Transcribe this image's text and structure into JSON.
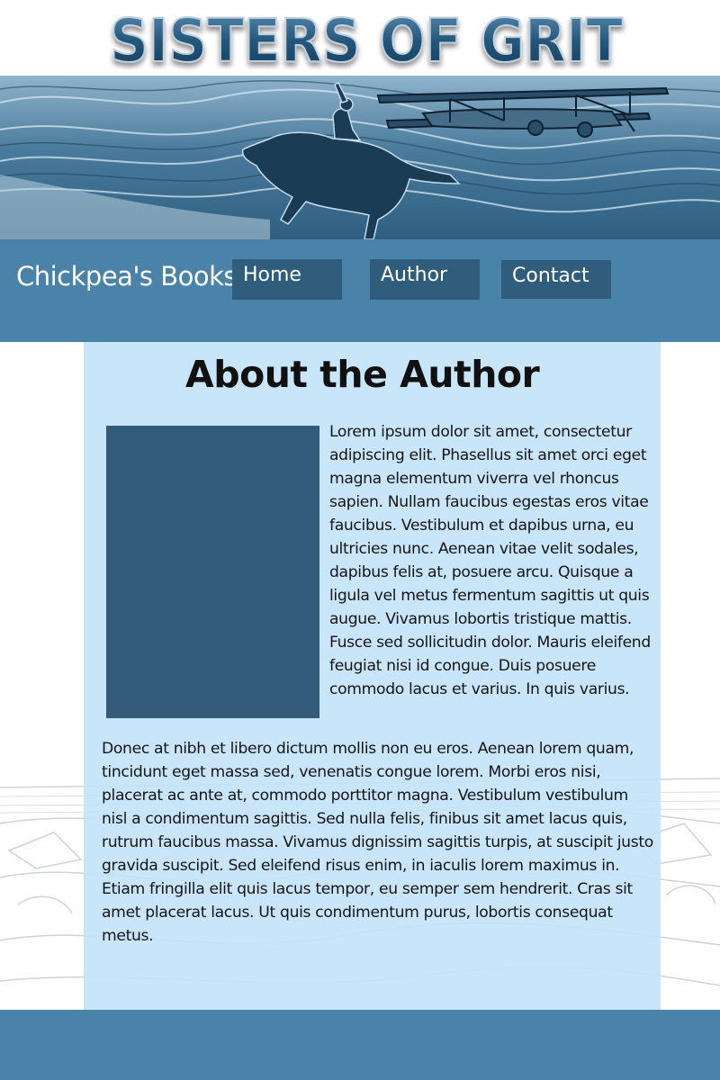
{
  "banner": {
    "title": "SISTERS OF GRIT"
  },
  "nav": {
    "site_name": "Chickpea's Books",
    "items": [
      {
        "label": "Home"
      },
      {
        "label": "Author"
      },
      {
        "label": "Contact"
      }
    ]
  },
  "main": {
    "heading": "About the Author",
    "paragraph1": "Lorem ipsum dolor sit amet, consectetur adipiscing elit. Phasellus sit amet orci eget magna elementum viverra vel rhoncus sapien. Nullam faucibus egestas eros vitae faucibus. Vestibulum et dapibus urna, eu ultricies nunc. Aenean vitae velit sodales, dapibus felis at, posuere arcu. Quisque a ligula vel metus fermentum sagittis ut quis augue. Vivamus lobortis tristique mattis. Fusce sed sollicitudin dolor. Mauris eleifend feugiat nisi id congue. Duis posuere commodo lacus et varius. In quis varius.",
    "paragraph2": "Donec at nibh et libero dictum mollis non eu eros. Aenean lorem quam, tincidunt eget massa sed, venenatis congue lorem. Morbi eros nisi, placerat ac ante at, commodo porttitor magna. Vestibulum vestibulum nisl a condimentum sagittis. Sed nulla felis, finibus sit amet lacus quis, rutrum faucibus massa. Vivamus dignissim sagittis turpis, at suscipit justo gravida suscipit. Sed eleifend risus enim, in iaculis lorem maximus in. Etiam fringilla elit quis lacus tempor, eu semper sem hendrerit. Cras sit amet placerat lacus. Ut quis condimentum purus, lobortis consequat metus."
  },
  "colors": {
    "nav_bar": "#4a83a9",
    "nav_button": "#315d7d",
    "content_panel": "#c3e2f8",
    "author_photo_placeholder": "#325c79",
    "title_text": "#1c4e6e"
  }
}
